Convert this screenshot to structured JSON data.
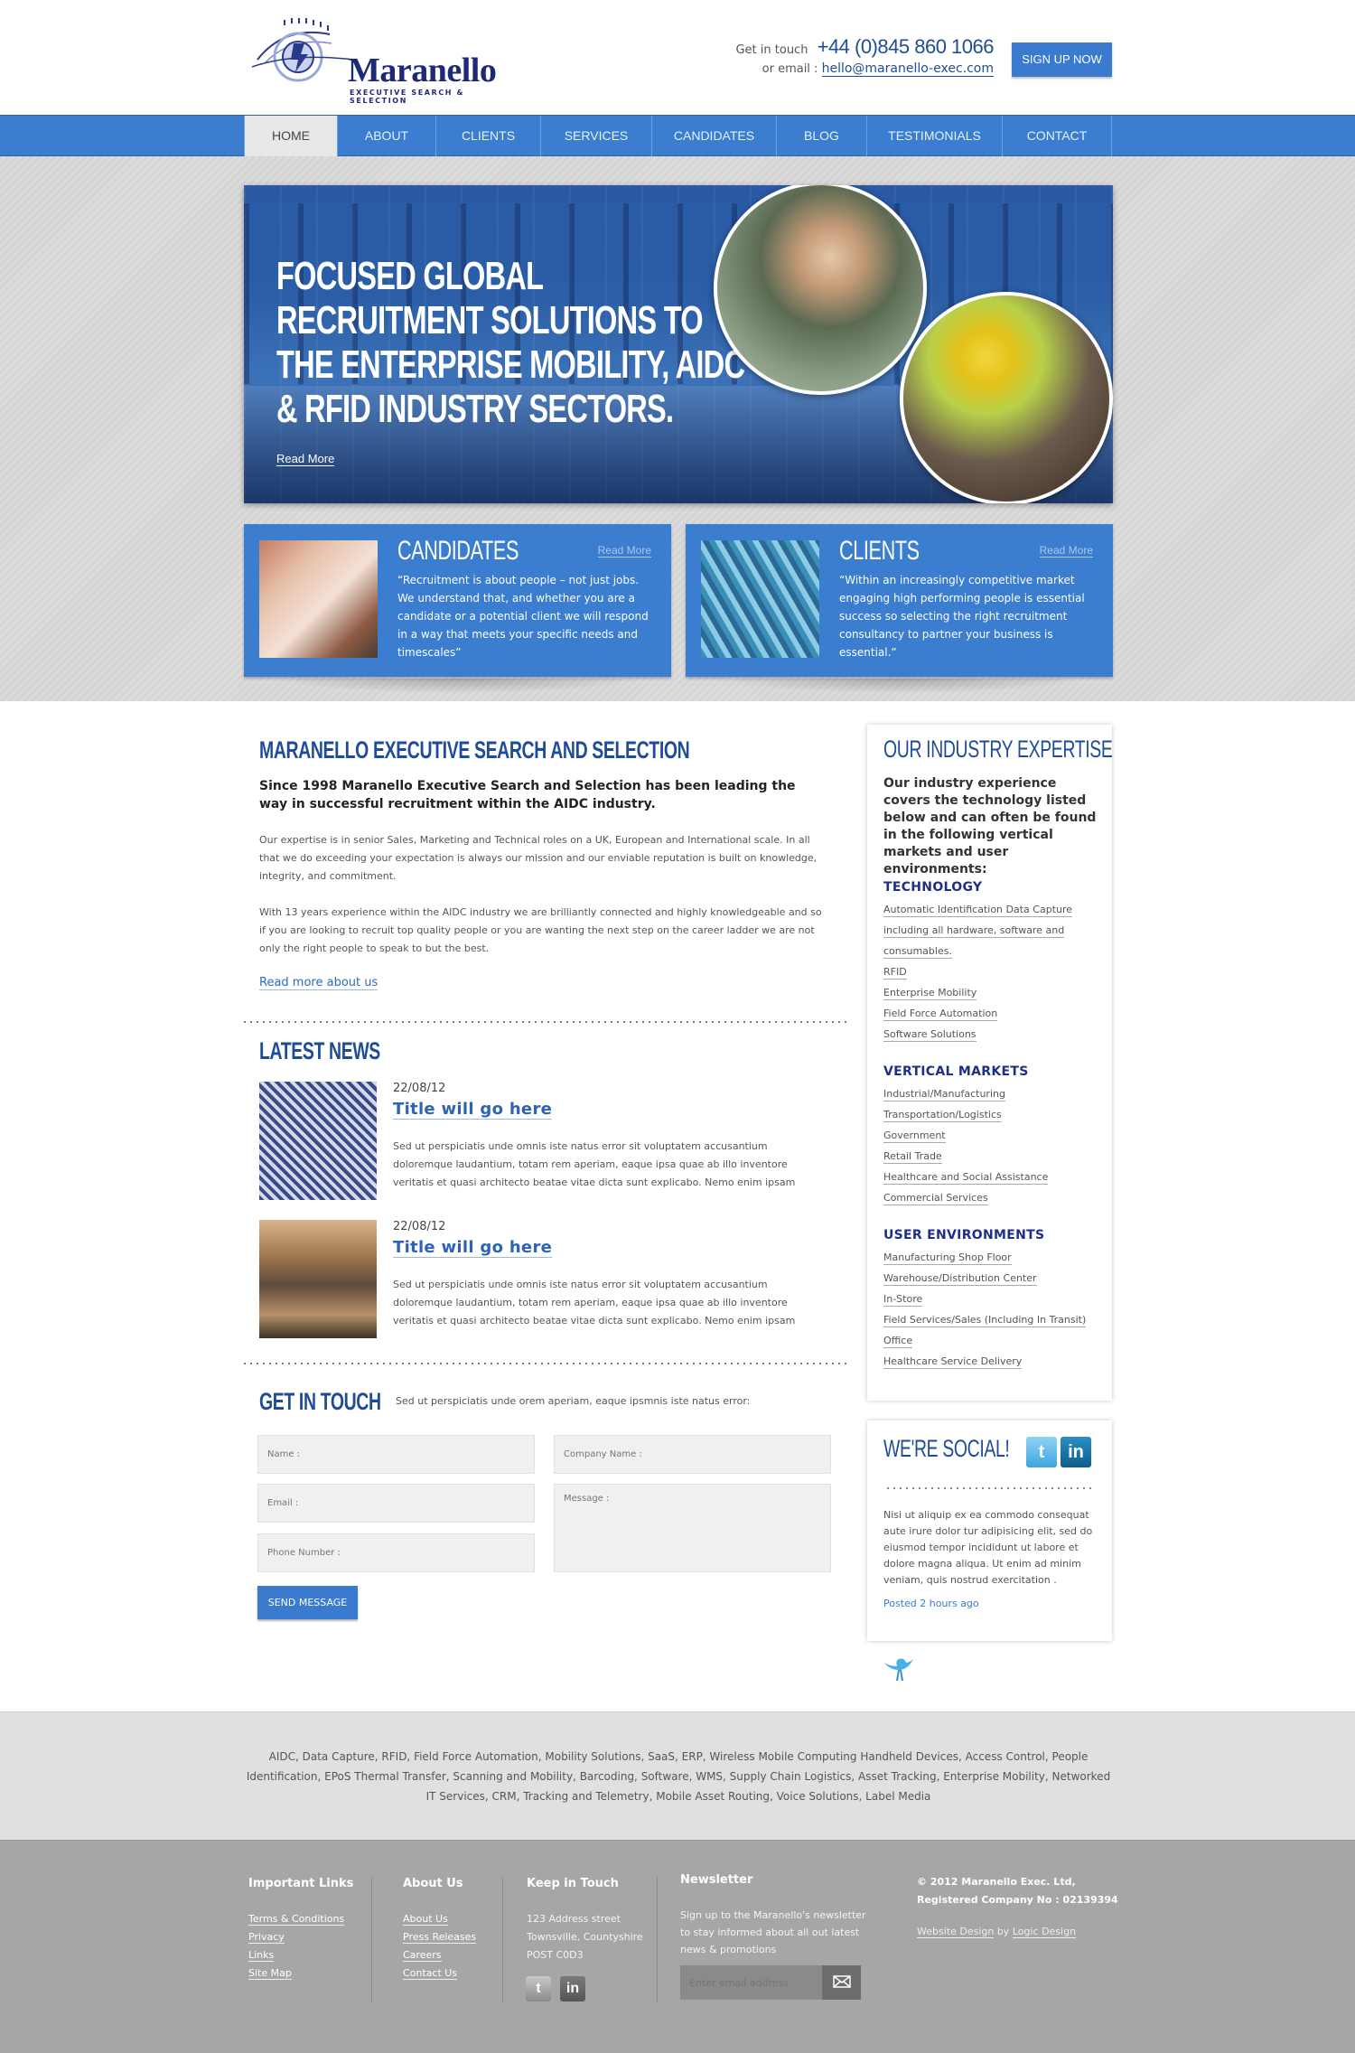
{
  "brand": {
    "name": "Maranello",
    "tagline": "EXECUTIVE SEARCH & SELECTION"
  },
  "header": {
    "get_in_touch_label": "Get in touch",
    "phone": "+44 (0)845 860 1066",
    "email_label": "or email :",
    "email": "hello@maranello-exec.com",
    "signup_label": "SIGN UP NOW"
  },
  "nav": {
    "items": [
      {
        "label": "HOME",
        "active": true
      },
      {
        "label": "ABOUT"
      },
      {
        "label": "CLIENTS"
      },
      {
        "label": "SERVICES"
      },
      {
        "label": "CANDIDATES"
      },
      {
        "label": "BLOG"
      },
      {
        "label": "TESTIMONIALS"
      },
      {
        "label": "CONTACT"
      }
    ]
  },
  "hero": {
    "lines": [
      "FOCUSED GLOBAL",
      "RECRUITMENT SOLUTIONS TO",
      "THE ENTERPRISE MOBILITY, AIDC",
      "& RFID INDUSTRY SECTORS."
    ],
    "read_more": "Read More"
  },
  "promos": {
    "candidates": {
      "title": "CANDIDATES",
      "read_more": "Read More",
      "text": "“Recruitment is about people – not just jobs. We understand that, and whether you are a candidate or a potential client we will respond in a way that meets your specific needs and timescales”"
    },
    "clients": {
      "title": "CLIENTS",
      "read_more": "Read More",
      "text": "“Within an increasingly competitive market engaging high performing people is essential success so selecting the right recruitment consultancy to partner your business is essential.”"
    }
  },
  "about": {
    "title": "MARANELLO EXECUTIVE SEARCH AND SELECTION",
    "lead": "Since 1998 Maranello Executive Search and Selection has been leading the way in successful recruitment within the AIDC industry.",
    "para1": "Our expertise is in senior Sales, Marketing and Technical roles on a UK, European and International scale.  In all that we do exceeding your expectation is always our mission and our enviable reputation is built on knowledge, integrity, and commitment.",
    "para2": "With 13 years experience within the AIDC industry we are brilliantly connected and highly knowledgeable and so if you are looking to recruit top quality people or you are wanting the next step on the career ladder we are not only the right people to speak to but the best.",
    "read_more": "Read more about us"
  },
  "news": {
    "title": "LATEST NEWS",
    "items": [
      {
        "date": "22/08/12",
        "title": "Title will go here",
        "text": "Sed ut perspiciatis unde omnis iste natus error sit voluptatem accusantium doloremque laudantium, totam rem aperiam, eaque ipsa quae ab illo inventore veritatis et quasi architecto beatae vitae dicta sunt explicabo. Nemo enim ipsam"
      },
      {
        "date": "22/08/12",
        "title": "Title will go here",
        "text": "Sed ut perspiciatis unde omnis iste natus error sit voluptatem accusantium doloremque laudantium, totam rem aperiam, eaque ipsa quae ab illo inventore veritatis et quasi architecto beatae vitae dicta sunt explicabo. Nemo enim ipsam"
      }
    ]
  },
  "contact_form": {
    "title": "GET IN TOUCH",
    "subtitle": "Sed ut perspiciatis unde orem aperiam, eaque ipsmnis iste natus error:",
    "name_placeholder": "Name :",
    "email_placeholder": "Email :",
    "phone_placeholder": "Phone Number :",
    "company_placeholder": "Company Name :",
    "message_placeholder": "Message :",
    "send_label": "SEND MESSAGE"
  },
  "expertise": {
    "title": "OUR INDUSTRY EXPERTISE",
    "intro": "Our industry experience covers the technology listed below and can often be found in the following vertical markets and user environments:",
    "technology": {
      "heading": "TECHNOLOGY",
      "items": [
        "Automatic Identification Data Capture",
        "including all hardware, software and",
        "consumables.",
        "RFID",
        "Enterprise Mobility",
        "Field Force Automation",
        "Software Solutions"
      ]
    },
    "vertical": {
      "heading": "VERTICAL MARKETS",
      "items": [
        "Industrial/Manufacturing",
        "Transportation/Logistics",
        "Government",
        "Retail Trade",
        "Healthcare and Social Assistance",
        "Commercial Services"
      ]
    },
    "environments": {
      "heading": "USER ENVIRONMENTS",
      "items": [
        "Manufacturing Shop Floor",
        "Warehouse/Distribution Center",
        "In-Store",
        "Field Services/Sales (Including In Transit)",
        "Office",
        "Healthcare Service Delivery"
      ]
    }
  },
  "social": {
    "title": "WE'RE SOCIAL!",
    "twitter_glyph": "t",
    "linkedin_glyph": "in",
    "tweet": "Nisi ut aliquip ex ea commodo consequat aute irure dolor tur adipisicing elit, sed do eiusmod tempor incididunt ut labore et dolore magna aliqua. Ut enim ad minim veniam, quis nostrud exercitation .",
    "posted": "Posted 2 hours ago"
  },
  "tags": "AIDC, Data Capture, RFID, Field Force Automation, Mobility Solutions, SaaS, ERP, Wireless Mobile Computing Handheld Devices, Access Control, People Identification, EPoS Thermal Transfer, Scanning and Mobility, Barcoding, Software,  WMS, Supply Chain Logistics, Asset Tracking, Enterprise Mobility, Networked IT Services, CRM, Tracking and Telemetry, Mobile Asset Routing, Voice Solutions, Label Media",
  "footer": {
    "important_links": {
      "heading": "Important Links",
      "items": [
        "Terms & Conditions",
        "Privacy",
        "Links",
        "Site Map"
      ]
    },
    "about_us": {
      "heading": "About Us",
      "items": [
        "About Us",
        "Press Releases",
        "Careers",
        "Contact Us"
      ]
    },
    "keep_in_touch": {
      "heading": "Keep in Touch",
      "address": [
        "123 Address street",
        "Townsville, Countyshire",
        "POST C0D3"
      ],
      "twitter_glyph": "t",
      "linkedin_glyph": "in"
    },
    "newsletter": {
      "heading": "Newsletter",
      "text": "Sign up to the Maranello's newsletter to stay informed about all out latest news & promotions",
      "placeholder": "Enter email address"
    },
    "legal": {
      "copyright": "© 2012 Maranello Exec. Ltd,",
      "company_no": "Registered Company No : 02139394",
      "credit_prefix": "Website Design",
      "credit_by": " by ",
      "credit_name": "Logic Design"
    }
  },
  "colors": {
    "brand_blue": "#3b7ecf",
    "heading_blue": "#1f4c9a",
    "navy": "#1e2a78"
  }
}
